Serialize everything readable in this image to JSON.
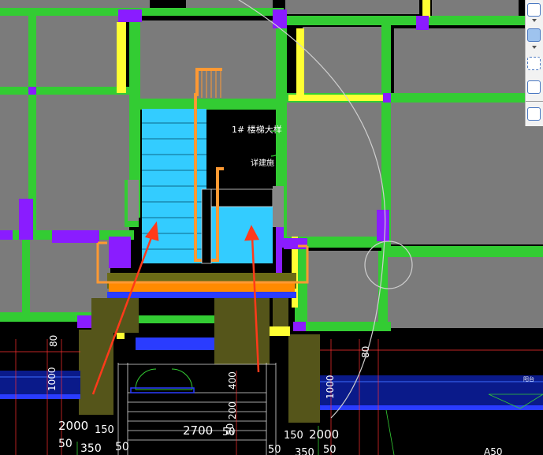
{
  "drawing": {
    "stair_title": "1# 楼梯大样",
    "stair_note": "详建施",
    "balcony_label": "阳台",
    "bottom_partial_label": "A50"
  },
  "dimensions": {
    "left_span": "2000",
    "left_span_small": "150",
    "left_50": "50",
    "left_350": "350",
    "left_bottom_50": "50",
    "center_span": "2700",
    "center_50": "50",
    "right_150": "150",
    "right_span": "2000",
    "right_50": "50",
    "right_50b": "50",
    "right_350": "350",
    "right_bottom_50": "50",
    "vert_1000_left": "1000",
    "vert_1000_right": "1000",
    "vert_80_left": "80",
    "vert_80_right": "80",
    "vert_400": "400",
    "vert_200": "200",
    "vert_50": "50"
  },
  "colors": {
    "background": "#000000",
    "slab": "#7b7b7b",
    "beam_green": "#33cc33",
    "column_purple": "#8a1cff",
    "beam_yellow": "#ffff33",
    "stair_cyan": "#33ccff",
    "orange_outline": "#ff9933",
    "olive": "#5a5a16",
    "blue_band": "#2a3cff",
    "annotation_arrow": "#ff3a1a"
  },
  "toolbar": {
    "icons": [
      "select-window-icon",
      "rectangle-icon",
      "dashed-rectangle-icon",
      "cube-icon",
      "list-icon"
    ]
  }
}
